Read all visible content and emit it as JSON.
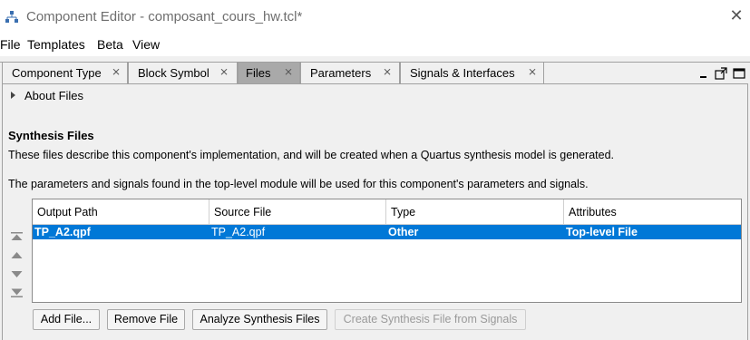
{
  "window": {
    "title": "Component Editor - composant_cours_hw.tcl*",
    "app_icon": "hierarchy-icon",
    "close_glyph": "✕"
  },
  "menubar": {
    "items": [
      "File",
      "Templates",
      "Beta",
      "View"
    ]
  },
  "tabs": [
    {
      "label": "Component Type",
      "active": false
    },
    {
      "label": "Block Symbol",
      "active": false
    },
    {
      "label": "Files",
      "active": true
    },
    {
      "label": "Parameters",
      "active": false
    },
    {
      "label": "Signals & Interfaces",
      "active": false
    }
  ],
  "tab_close_glyph": "⨯",
  "about": {
    "label": "About Files"
  },
  "synthesis": {
    "title": "Synthesis Files",
    "description": "These files describe this component's implementation, and will be created when a Quartus synthesis model is generated.",
    "note": "The parameters and signals found in the top-level module will be used for this component's parameters and signals.",
    "columns": [
      "Output Path",
      "Source File",
      "Type",
      "Attributes"
    ],
    "rows": [
      {
        "output_path": "TP_A2.qpf",
        "source_file": "TP_A2.qpf",
        "type": "Other",
        "attributes": "Top-level File",
        "selected": true
      }
    ],
    "buttons": {
      "add": "Add File...",
      "remove": "Remove File",
      "analyze": "Analyze Synthesis Files",
      "create": "Create Synthesis File from Signals"
    }
  },
  "colors": {
    "selection": "#0078d7",
    "active_tab": "#a9a9a9",
    "background": "#f0f0f0"
  }
}
